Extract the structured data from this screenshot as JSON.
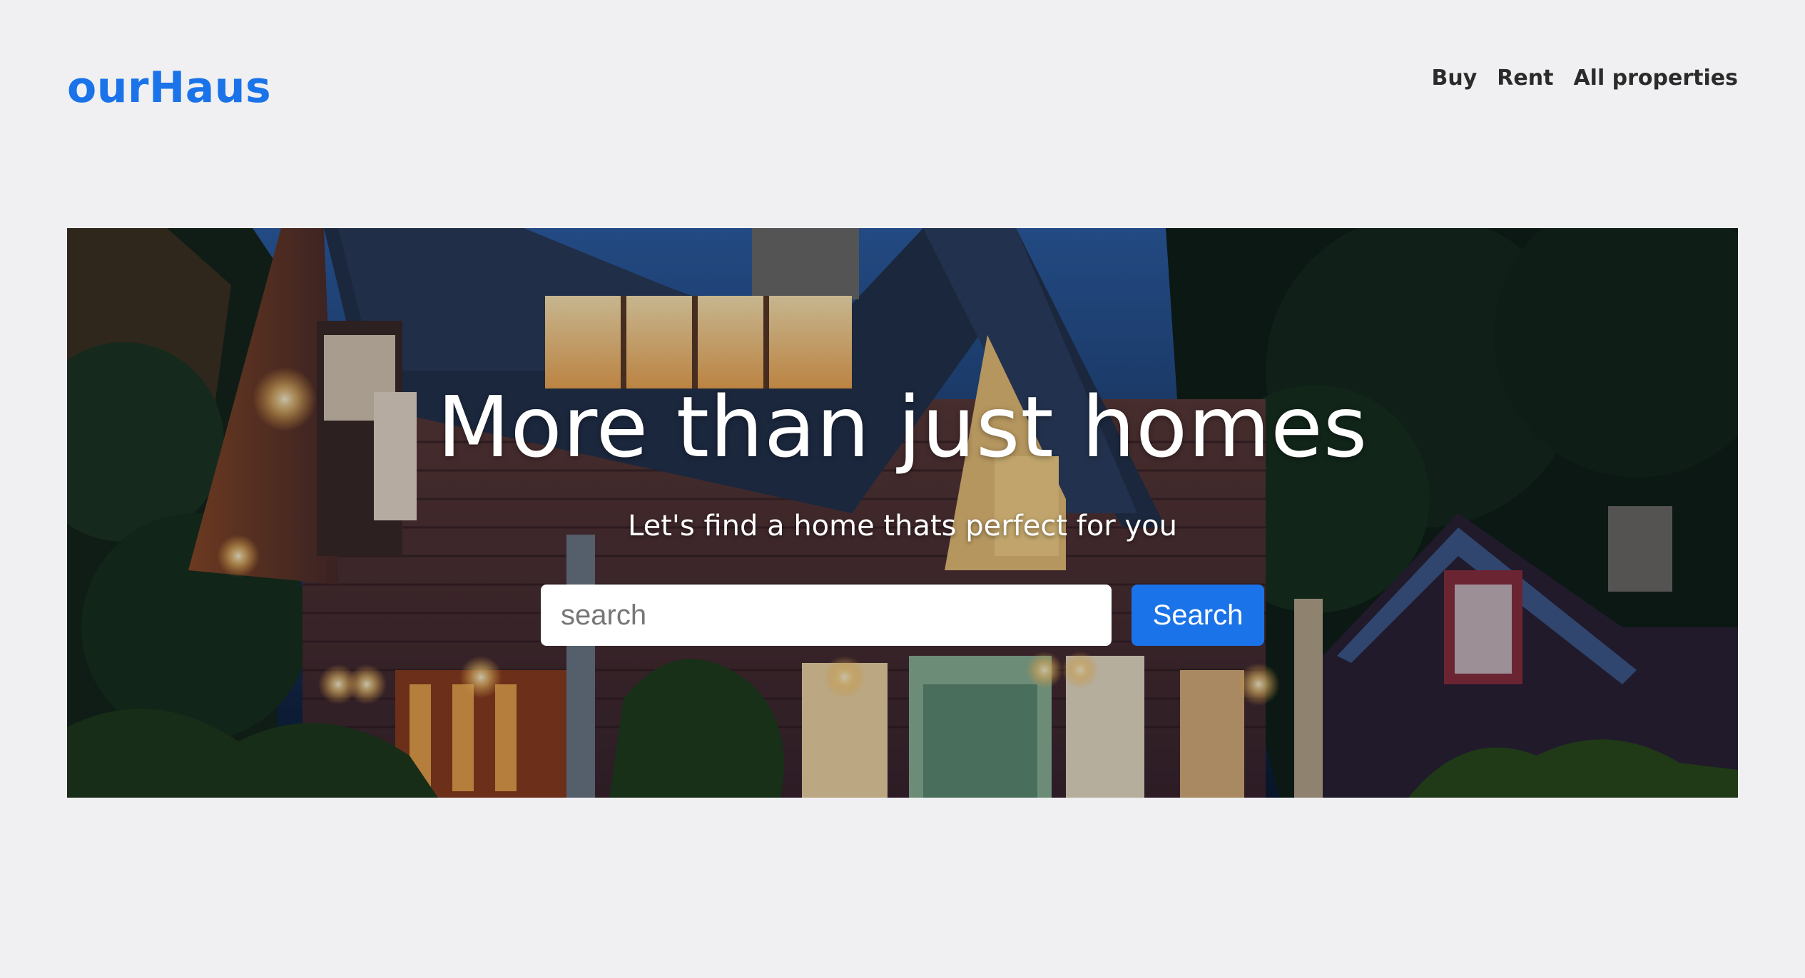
{
  "brand": {
    "name": "ourHaus",
    "color": "#1a73e8"
  },
  "nav": {
    "items": [
      {
        "label": "Buy"
      },
      {
        "label": "Rent"
      },
      {
        "label": "All properties"
      }
    ]
  },
  "hero": {
    "title": "More than just homes",
    "subtitle": "Let's find a home thats perfect for you",
    "search": {
      "placeholder": "search",
      "value": "",
      "button_label": "Search"
    }
  },
  "colors": {
    "background": "#f0f0f2",
    "accent": "#1a73e8",
    "nav_text": "#2b2b2b"
  }
}
